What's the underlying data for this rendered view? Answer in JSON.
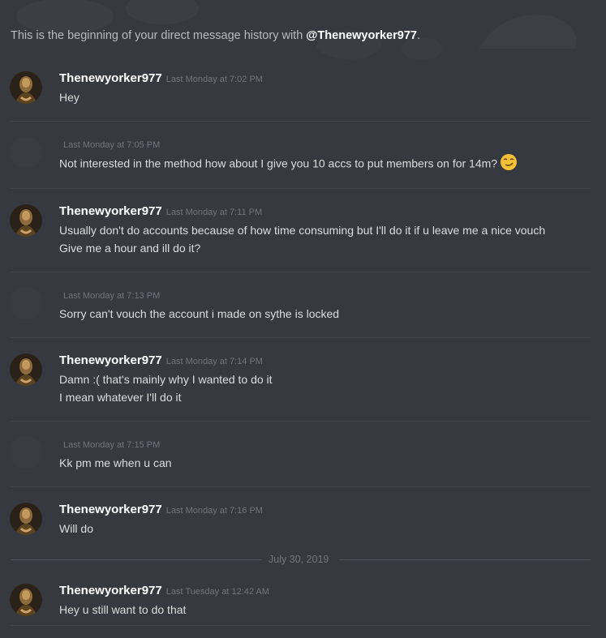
{
  "intro": {
    "prefix": "This is the beginning of your direct message history with ",
    "handle": "@Thenewyorker977",
    "suffix": "."
  },
  "messages": [
    {
      "author": "Thenewyorker977",
      "time": "Last Monday at 7:02 PM",
      "lines": [
        "Hey"
      ]
    },
    {
      "author": "",
      "time": "Last Monday at 7:05 PM",
      "lines": [
        "Not interested in the method how about I give you 10 accs to put members on for 14m?"
      ],
      "emoji": "smirk-emoji"
    },
    {
      "author": "Thenewyorker977",
      "time": "Last Monday at 7:11 PM",
      "lines": [
        "Usually don't do accounts because of how time consuming but I'll do it if u leave me a nice vouch",
        "Give me a hour and ill do it?"
      ]
    },
    {
      "author": "",
      "time": "Last Monday at 7:13 PM",
      "lines": [
        "Sorry can't vouch the account i made on sythe is locked"
      ]
    },
    {
      "author": "Thenewyorker977",
      "time": "Last Monday at 7:14 PM",
      "lines": [
        "Damn :( that's mainly why I wanted to do it",
        "I mean whatever I'll do it"
      ]
    },
    {
      "author": "",
      "time": "Last Monday at 7:15 PM",
      "lines": [
        "Kk pm me when u can"
      ]
    },
    {
      "author": "Thenewyorker977",
      "time": "Last Monday at 7:16 PM",
      "lines": [
        "Will do"
      ]
    },
    {
      "author": "Thenewyorker977",
      "time": "Last Tuesday at 12:42 AM",
      "lines": [
        "Hey u still want to do that"
      ]
    }
  ],
  "date_separator": "July 30, 2019",
  "colors": {
    "background": "#36393f",
    "text": "#dcddde",
    "timestamp": "#72767d",
    "author": "#ffffff"
  }
}
